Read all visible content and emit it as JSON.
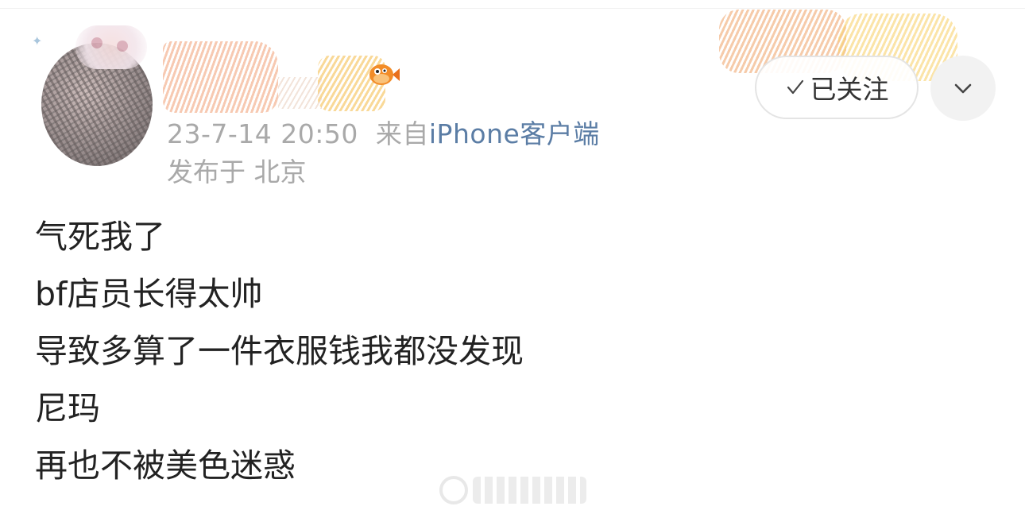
{
  "post": {
    "timestamp": "23-7-14 20:50",
    "source_prefix": "来自",
    "source_device": "iPhone客户端",
    "location": "发布于 北京",
    "lines": [
      "气死我了",
      "bf店员长得太帅",
      "导致多算了一件衣服钱我都没发现",
      "尼玛",
      "再也不被美色迷惑"
    ]
  },
  "actions": {
    "follow_label": "已关注",
    "check_icon": "check-icon",
    "more_icon": "chevron-down-icon"
  },
  "colors": {
    "meta_gray": "#a9a9a9",
    "device_link": "#5b7da5",
    "body_text": "#222222"
  }
}
